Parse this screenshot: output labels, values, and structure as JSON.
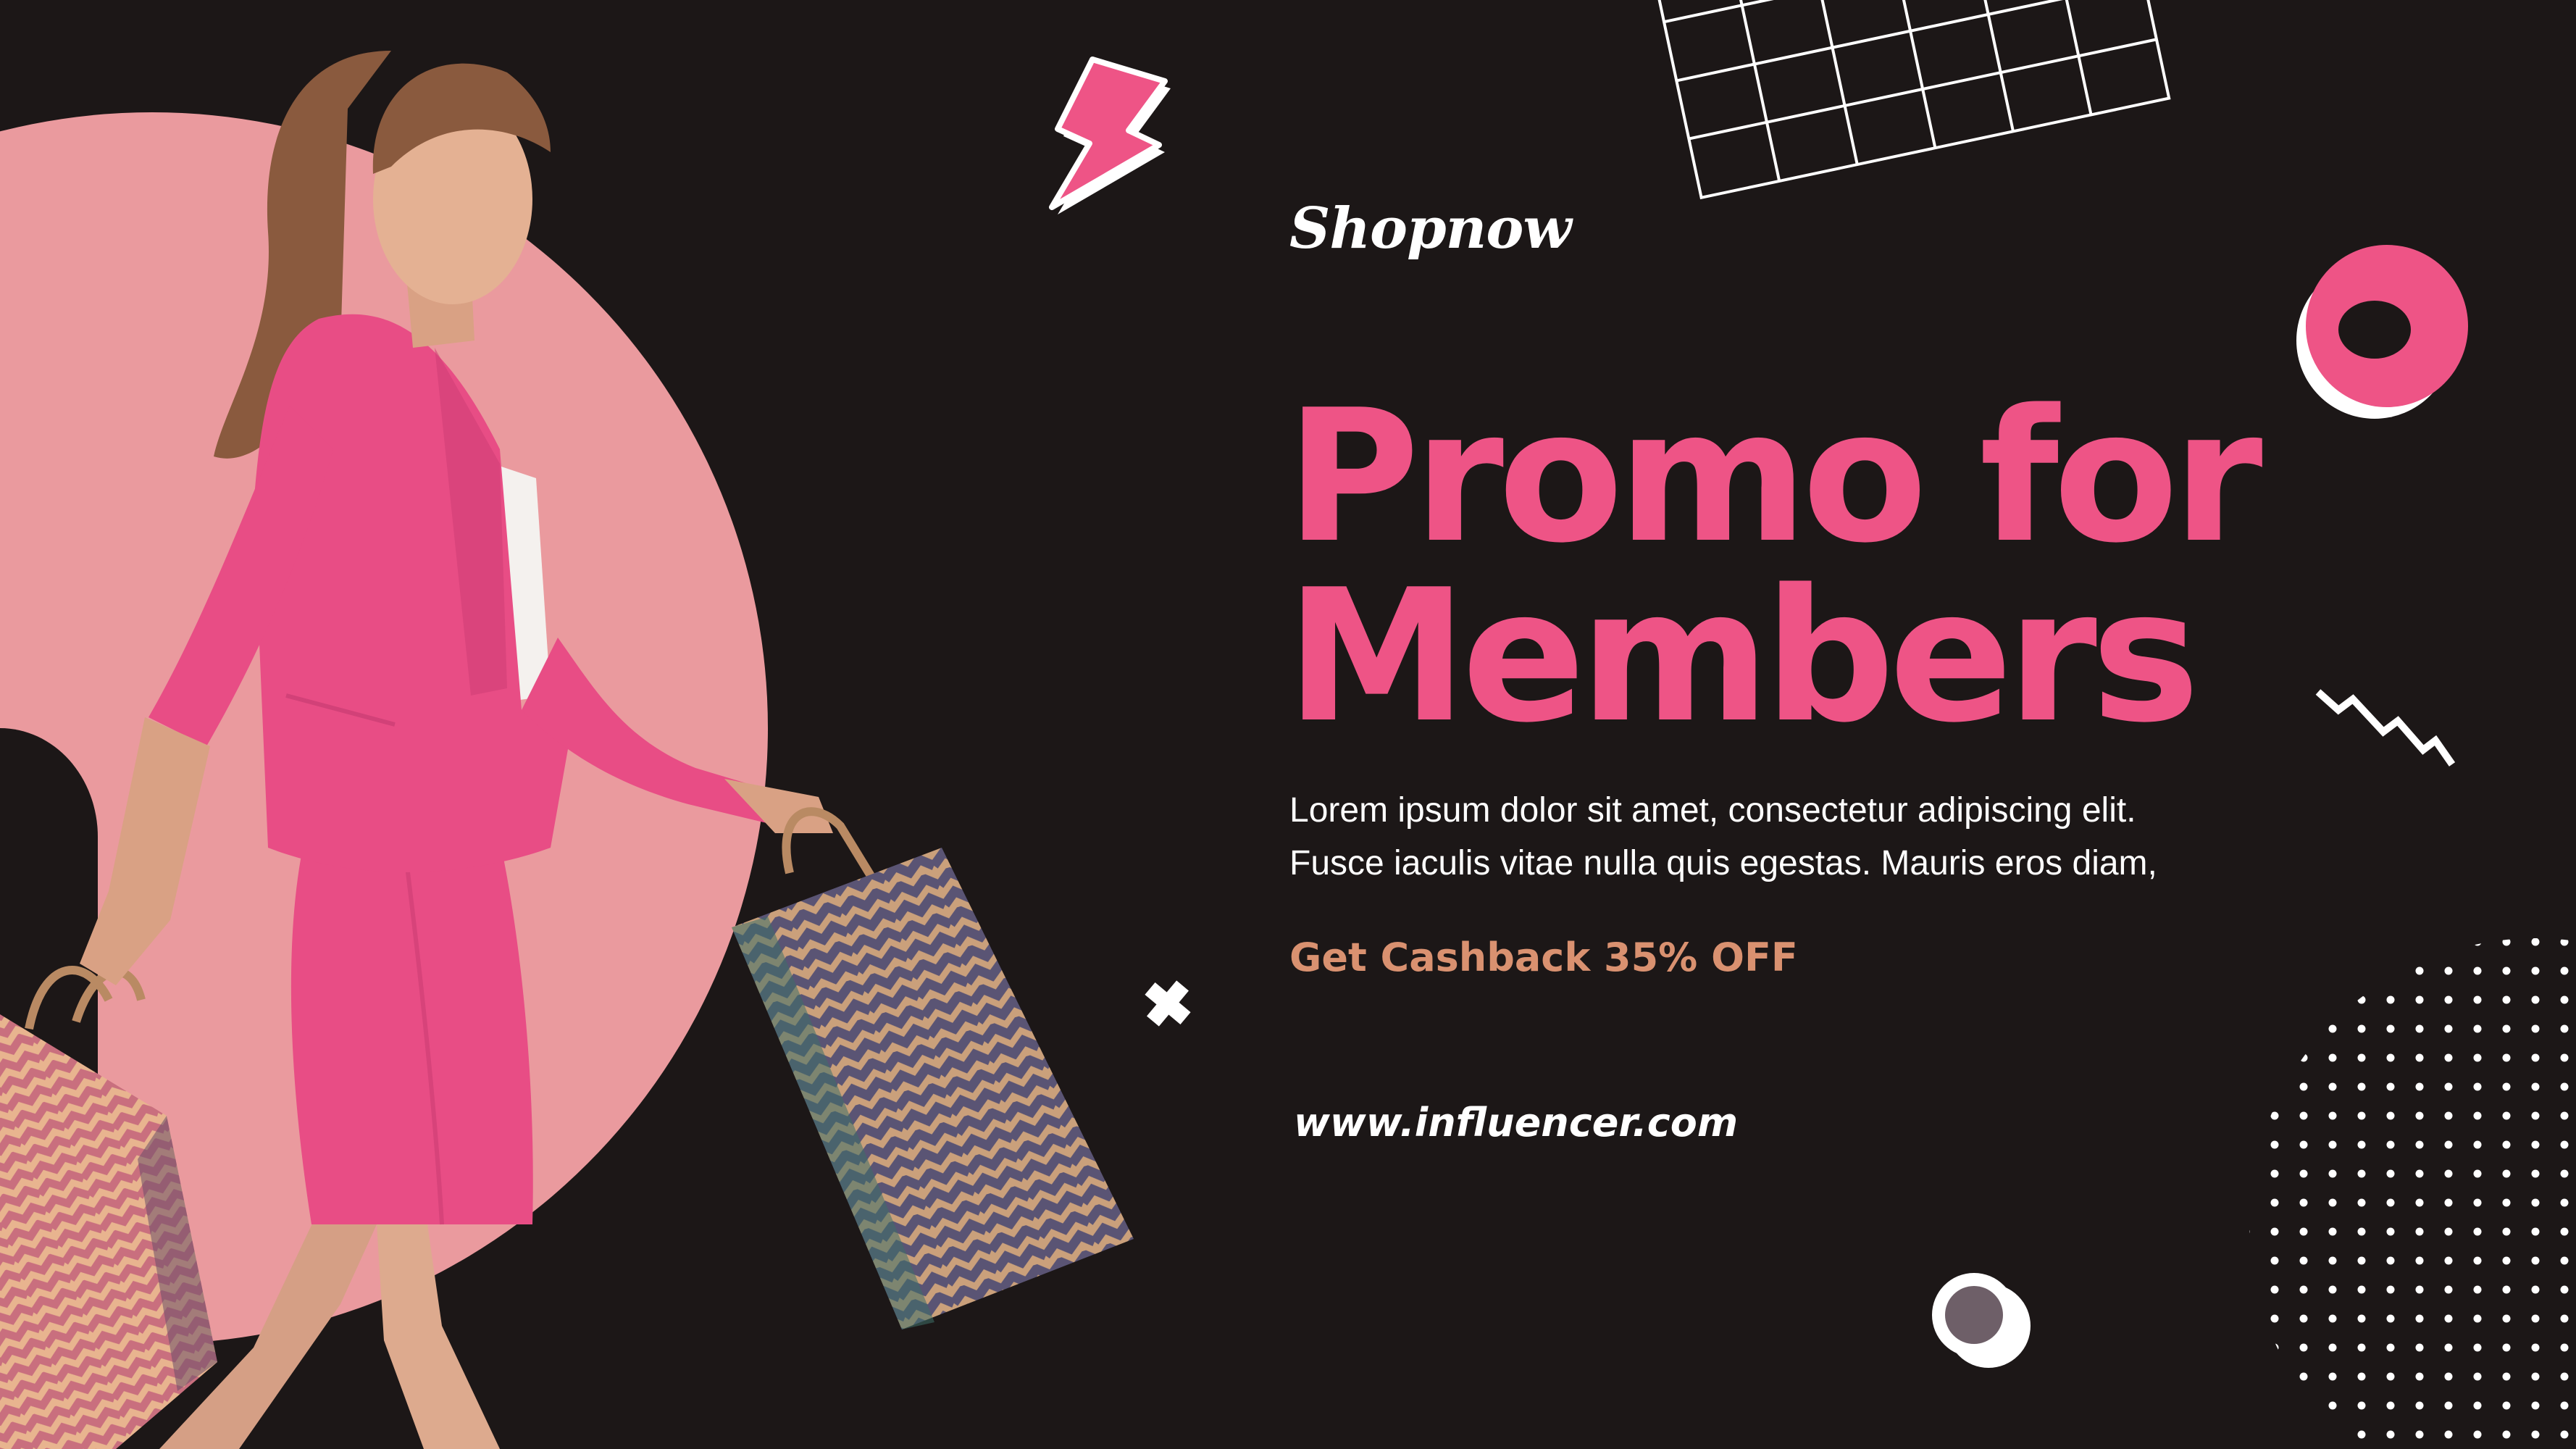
{
  "brand": {
    "logo_text": "Shopnow"
  },
  "headline": {
    "line1": "Promo for",
    "line2": "Members"
  },
  "body": {
    "line1": "Lorem ipsum dolor sit amet, consectetur adipiscing elit.",
    "line2": "Fusce iaculis vitae nulla quis egestas. Mauris eros diam,"
  },
  "offer": {
    "text": "Get Cashback 35% OFF"
  },
  "website": {
    "url": "www.influencer.com"
  },
  "colors": {
    "background": "#1c1717",
    "accent_pink": "#ee5486",
    "soft_pink": "#ea9a9e",
    "cashback": "#d99170",
    "text_white": "#ffffff"
  },
  "icons": [
    "lightning-bolt-icon",
    "grid-pattern-icon",
    "ring-icon",
    "zigzag-icon",
    "cross-icon",
    "dot-pattern-icon",
    "small-ring-icon",
    "shopping-bag-icon"
  ]
}
